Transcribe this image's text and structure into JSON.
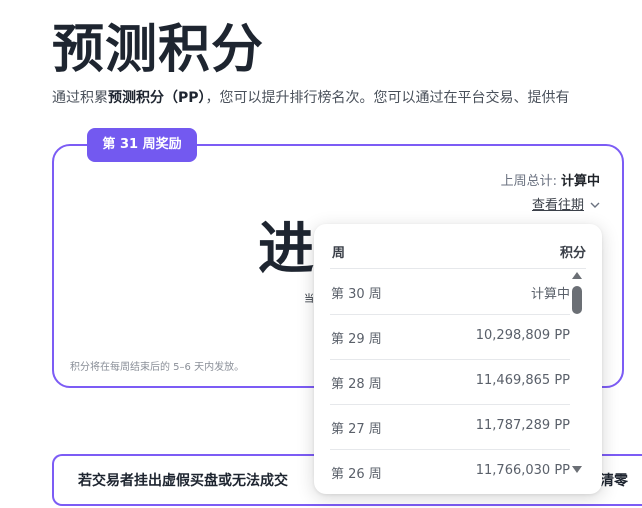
{
  "page": {
    "title": "预测积分",
    "intro_pre": "通过积累",
    "intro_bold": "预测积分（PP）",
    "intro_post": "，您可以提升排行榜名次。您可以通过在平台交易、提供有"
  },
  "reward_card": {
    "badge": "第 31 周奖励",
    "last_week_label": "上周总计:",
    "last_week_value": "计算中",
    "past_link": "查看往期",
    "status_big": "进",
    "status_sub": "当",
    "footnote": "积分将在每周结束后的 5–6 天内发放。"
  },
  "dropdown": {
    "col_week": "周",
    "col_points": "积分",
    "rows": [
      {
        "week": "第 30 周",
        "points": "计算中"
      },
      {
        "week": "第 29 周",
        "points": "10,298,809 PP"
      },
      {
        "week": "第 28 周",
        "points": "11,469,865 PP"
      },
      {
        "week": "第 27 周",
        "points": "11,787,289 PP"
      },
      {
        "week": "第 26 周",
        "points": "11,766,030 PP"
      }
    ]
  },
  "warning": {
    "text": "若交易者挂出虚假买盘或无法成交",
    "tail": "清零"
  },
  "colors": {
    "accent": "#7359f0",
    "border": "#7c5cf5",
    "heading": "#1e2530"
  }
}
